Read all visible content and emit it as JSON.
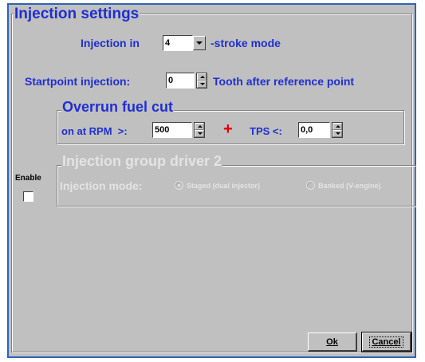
{
  "dialog": {
    "title": "Injection settings",
    "injection_mode_prefix": "Injection in",
    "stroke_value": "4",
    "injection_mode_suffix": "-stroke mode",
    "startpoint_label": "Startpoint injection:",
    "startpoint_value": "0",
    "startpoint_suffix": "Tooth after reference point"
  },
  "overrun": {
    "title": "Overrun fuel cut",
    "rpm_label": "on at RPM  >:",
    "rpm_value": "500",
    "plus": "+",
    "tps_label": "TPS <:",
    "tps_value": "0,0"
  },
  "group_driver": {
    "title": "Injection group driver 2",
    "enable_label": "Enable",
    "enable_checked": false,
    "mode_label": "Injection mode:",
    "options": [
      "Staged (dual injector)",
      "Banked (V-engine)"
    ],
    "selected": "Staged (dual injector)"
  },
  "buttons": {
    "ok": "Ok",
    "cancel": "Cancel"
  },
  "colors": {
    "label_blue": "#1f2fd0",
    "dialog_bg": "#c0c0c0",
    "border_blue": "#2f63b8",
    "plus_red": "#e00000",
    "disabled_text": "#e3e3e3"
  }
}
